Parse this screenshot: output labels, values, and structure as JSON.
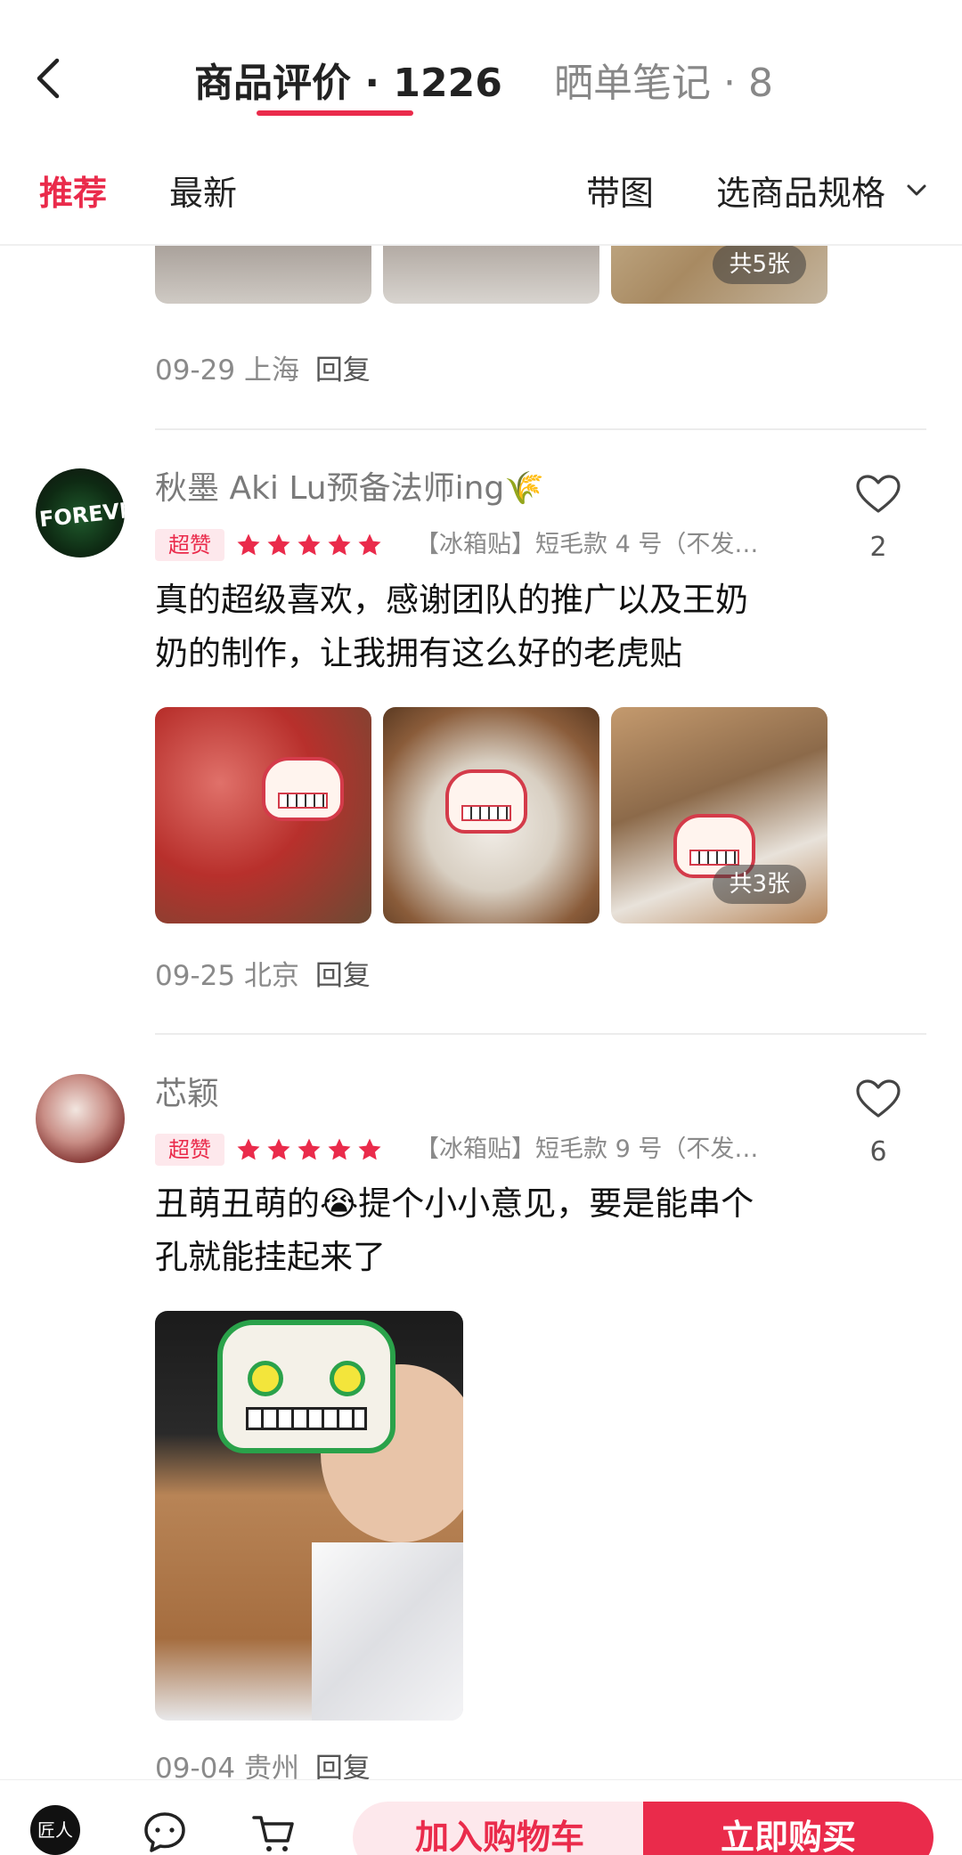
{
  "header": {
    "tab_reviews": "商品评价 · 1226",
    "tab_notes": "晒单笔记 · 8"
  },
  "filters": {
    "recommend": "推荐",
    "latest": "最新",
    "with_images": "带图",
    "select_spec": "选商品规格"
  },
  "colors": {
    "accent": "#ea2b4b",
    "badge_bg": "#fde8ec"
  },
  "reviews": [
    {
      "image_count_badge": "共5张",
      "date": "09-29",
      "location": "上海",
      "reply": "回复"
    },
    {
      "user": "秋墨 Aki Lu预备法师ing🌾",
      "badge": "超赞",
      "rating": 5,
      "spec": "【冰箱贴】短毛款 4 号（不发…",
      "likes": "2",
      "text": "真的超级喜欢，感谢团队的推广以及王奶奶的制作，让我拥有这么好的老虎贴",
      "image_count_badge": "共3张",
      "date": "09-25",
      "location": "北京",
      "reply": "回复"
    },
    {
      "user": "芯颖",
      "badge": "超赞",
      "rating": 5,
      "spec": "【冰箱贴】短毛款 9 号（不发…",
      "likes": "6",
      "text": "丑萌丑萌的😭提个小小意见，要是能串个孔就能挂起来了",
      "date": "09-04",
      "location": "贵州",
      "reply": "回复"
    }
  ],
  "bottom_bar": {
    "shop_logo_text": "匠人",
    "add_to_cart": "加入购物车",
    "buy_now": "立即购买"
  }
}
